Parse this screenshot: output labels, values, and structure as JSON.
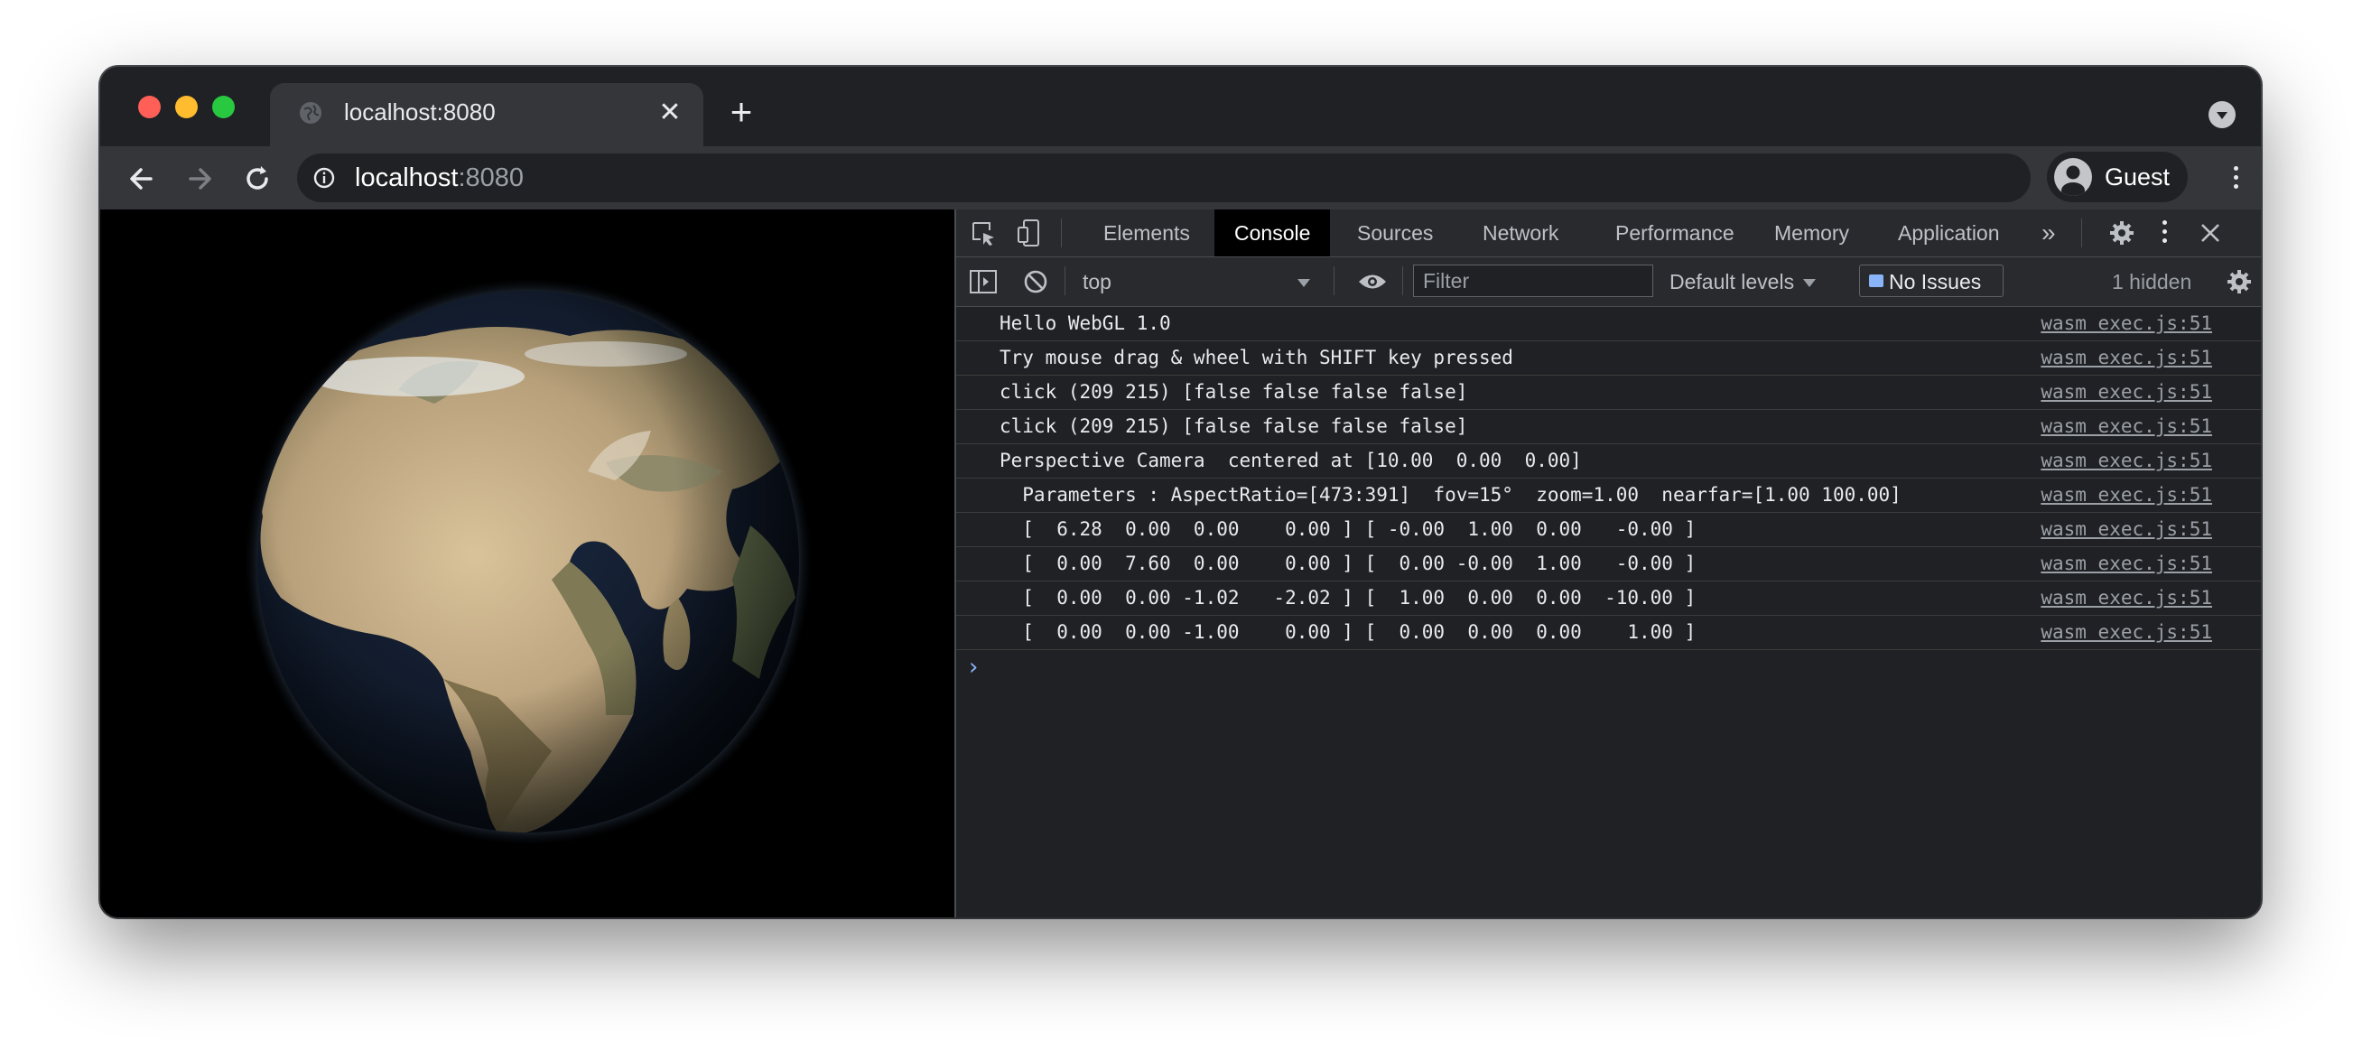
{
  "browser": {
    "tab_title": "localhost:8080",
    "new_tab_symbol": "+",
    "close_symbol": "✕",
    "url_host": "localhost",
    "url_port": ":8080",
    "profile_label": "Guest",
    "icons": [
      "globe-icon",
      "close-icon",
      "plus-icon",
      "tab-search-icon",
      "back-arrow-icon",
      "forward-arrow-icon",
      "reload-icon",
      "info-icon",
      "user-avatar-icon",
      "more-vert-icon"
    ]
  },
  "devtools": {
    "tabs": [
      "Elements",
      "Console",
      "Sources",
      "Network",
      "Performance",
      "Memory",
      "Application"
    ],
    "active_tab": "Console",
    "more_tabs_symbol": "»",
    "context": "top",
    "filter_placeholder": "Filter",
    "levels_label": "Default levels",
    "issues_label": "No Issues",
    "hidden_label": "1 hidden",
    "prompt_symbol": "›",
    "icons": [
      "inspect-element-icon",
      "device-toolbar-icon",
      "settings-gear-icon",
      "more-vert-icon",
      "close-icon",
      "sidebar-toggle-icon",
      "clear-console-icon",
      "eye-icon",
      "issue-icon",
      "console-settings-icon"
    ]
  },
  "console": {
    "logs": [
      {
        "msg": "Hello WebGL 1.0",
        "src": "wasm exec.js:51"
      },
      {
        "msg": "Try mouse drag & wheel with SHIFT key pressed",
        "src": "wasm exec.js:51"
      },
      {
        "msg": "click (209 215) [false false false false]",
        "src": "wasm exec.js:51"
      },
      {
        "msg": "click (209 215) [false false false false]",
        "src": "wasm exec.js:51"
      },
      {
        "msg": "Perspective Camera  centered at [10.00  0.00  0.00]",
        "src": "wasm exec.js:51"
      },
      {
        "msg": "  Parameters : AspectRatio=[473:391]  fov=15°  zoom=1.00  nearfar=[1.00 100.00]",
        "src": "wasm exec.js:51"
      },
      {
        "msg": "  [  6.28  0.00  0.00    0.00 ] [ -0.00  1.00  0.00   -0.00 ]",
        "src": "wasm exec.js:51"
      },
      {
        "msg": "  [  0.00  7.60  0.00    0.00 ] [  0.00 -0.00  1.00   -0.00 ]",
        "src": "wasm exec.js:51"
      },
      {
        "msg": "  [  0.00  0.00 -1.02   -2.02 ] [  1.00  0.00  0.00  -10.00 ]",
        "src": "wasm exec.js:51"
      },
      {
        "msg": "  [  0.00  0.00 -1.00    0.00 ] [  0.00  0.00  0.00    1.00 ]",
        "src": "wasm exec.js:51"
      }
    ]
  },
  "canvas": {
    "content": "rendered earth globe (WebGL)"
  }
}
